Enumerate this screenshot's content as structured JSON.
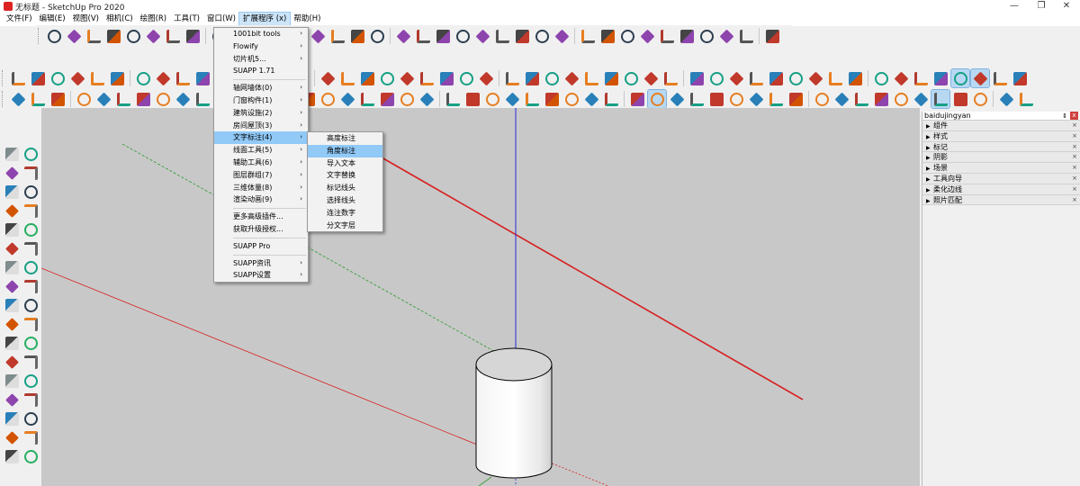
{
  "window": {
    "title": "无标题 - SketchUp Pro 2020",
    "controls": [
      "—",
      "❐",
      "✕"
    ]
  },
  "menubar": [
    {
      "label": "文件(F)"
    },
    {
      "label": "编辑(E)"
    },
    {
      "label": "视图(V)"
    },
    {
      "label": "相机(C)"
    },
    {
      "label": "绘图(R)"
    },
    {
      "label": "工具(T)"
    },
    {
      "label": "窗口(W)"
    },
    {
      "label": "扩展程序 (x)",
      "active": true
    },
    {
      "label": "帮助(H)"
    }
  ],
  "extensions_menu": {
    "items": [
      {
        "label": "1001bit tools",
        "submenu": true
      },
      {
        "label": "Flowify",
        "submenu": true
      },
      {
        "label": "切片机5...",
        "submenu": true
      },
      {
        "label": "SUAPP 1.71",
        "submenu": false
      },
      {
        "sep": true
      },
      {
        "label": "轴网墙体(0)",
        "submenu": true
      },
      {
        "label": "门窗构件(1)",
        "submenu": true
      },
      {
        "label": "建筑设施(2)",
        "submenu": true
      },
      {
        "label": "房间屋顶(3)",
        "submenu": true
      },
      {
        "label": "文字标注(4)",
        "submenu": true,
        "highlight": true
      },
      {
        "label": "线面工具(5)",
        "submenu": true
      },
      {
        "label": "辅助工具(6)",
        "submenu": true
      },
      {
        "label": "图层群组(7)",
        "submenu": true
      },
      {
        "label": "三维体量(8)",
        "submenu": true
      },
      {
        "label": "渲染动画(9)",
        "submenu": true
      },
      {
        "sep": true
      },
      {
        "label": "更多高级插件...",
        "submenu": false
      },
      {
        "label": "获取升级授权...",
        "submenu": false
      },
      {
        "sep": true
      },
      {
        "label": "SUAPP Pro",
        "submenu": false
      },
      {
        "sep": true
      },
      {
        "label": "SUAPP资讯",
        "submenu": true
      },
      {
        "label": "SUAPP设置",
        "submenu": true
      }
    ]
  },
  "text_annotation_submenu": {
    "items": [
      {
        "label": "高度标注"
      },
      {
        "label": "角度标注",
        "highlight": true
      },
      {
        "label": "导入文本"
      },
      {
        "label": "文字替换"
      },
      {
        "label": "标记线头"
      },
      {
        "label": "选择线头"
      },
      {
        "label": "连注数字"
      },
      {
        "label": "分文字层"
      }
    ]
  },
  "tray": {
    "title": "baidujingyan",
    "pin": "⇕",
    "close": "x",
    "panels": [
      {
        "label": "组件"
      },
      {
        "label": "样式"
      },
      {
        "label": "标记"
      },
      {
        "label": "阴影"
      },
      {
        "label": "场景"
      },
      {
        "label": "工具向导"
      },
      {
        "label": "柔化边线"
      },
      {
        "label": "照片匹配"
      }
    ]
  },
  "colors": {
    "viewport_bg": "#c8c8c8",
    "axis_red": "#d81e1e",
    "axis_blue": "#2a2ad8",
    "axis_green": "#2a9a2a",
    "menu_highlight": "#91c9f7"
  }
}
